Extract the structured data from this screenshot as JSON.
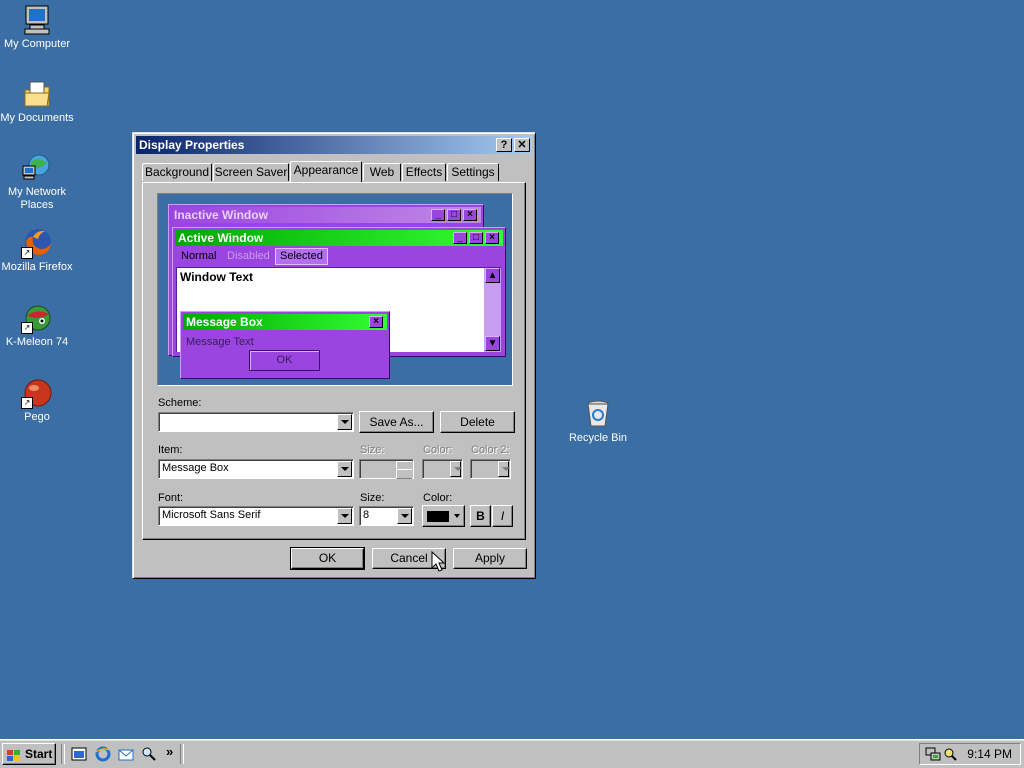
{
  "desktop": {
    "icons": [
      {
        "label": "My Computer"
      },
      {
        "label": "My Documents"
      },
      {
        "label": "My Network Places"
      },
      {
        "label": "Mozilla Firefox"
      },
      {
        "label": "K-Meleon 74"
      },
      {
        "label": "Pego"
      },
      {
        "label": "Recycle Bin"
      }
    ]
  },
  "dialog": {
    "title": "Display Properties",
    "help_label": "?",
    "close_label": "✕",
    "tabs": [
      {
        "label": "Background"
      },
      {
        "label": "Screen Saver"
      },
      {
        "label": "Appearance",
        "active": true
      },
      {
        "label": "Web"
      },
      {
        "label": "Effects"
      },
      {
        "label": "Settings"
      }
    ],
    "preview": {
      "inactive_title": "Inactive Window",
      "active_title": "Active Window",
      "menu": {
        "normal": "Normal",
        "disabled": "Disabled",
        "selected": "Selected"
      },
      "window_text": "Window Text",
      "msgbox_title": "Message Box",
      "msgbox_text": "Message Text",
      "msgbox_ok": "OK",
      "colors": {
        "purple": "#9b45e0",
        "active_title": "#00c800",
        "desktop": "#3a6ea5"
      }
    },
    "scheme": {
      "label": "Scheme:",
      "value": "",
      "save_as": "Save As...",
      "delete": "Delete"
    },
    "item": {
      "label": "Item:",
      "value": "Message Box",
      "size_label": "Size:",
      "color_label": "Color:",
      "color2_label": "Color 2:"
    },
    "font": {
      "label": "Font:",
      "value": "Microsoft Sans Serif",
      "size_label": "Size:",
      "size_value": "8",
      "color_label": "Color:",
      "color_value": "#000000",
      "bold": "B",
      "italic": "I"
    },
    "buttons": {
      "ok": "OK",
      "cancel": "Cancel",
      "apply": "Apply"
    }
  },
  "taskbar": {
    "start_label": "Start",
    "chevron": "»",
    "clock": "9:14 PM"
  }
}
